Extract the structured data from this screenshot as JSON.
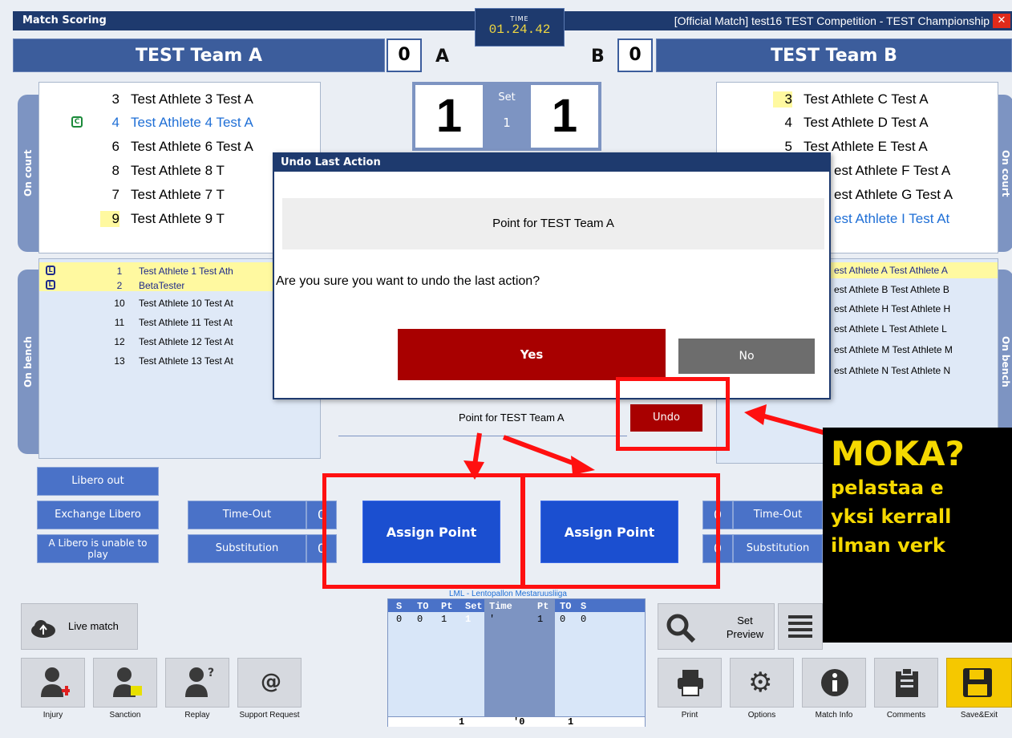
{
  "window": {
    "title": "Match Scoring",
    "match_info": "[Official Match]  test16  TEST Competition - TEST Championship",
    "close": "✕"
  },
  "time": {
    "label": "TIME",
    "value": "01.24.42"
  },
  "teamA": {
    "name": "TEST Team A",
    "score": "0",
    "side": "A",
    "sets": "1"
  },
  "teamB": {
    "name": "TEST Team B",
    "score": "0",
    "side": "B",
    "sets": "1"
  },
  "set": {
    "label": "Set",
    "number": "1"
  },
  "tabs": {
    "on_court": "On court",
    "on_bench": "On bench"
  },
  "courtA": [
    {
      "num": "3",
      "name": "Test Athlete 3 Test A"
    },
    {
      "num": "4",
      "name": "Test Athlete 4 Test A",
      "captain": "C"
    },
    {
      "num": "6",
      "name": "Test Athlete 6 Test A"
    },
    {
      "num": "8",
      "name": "Test Athlete 8 T"
    },
    {
      "num": "7",
      "name": "Test Athlete 7 T"
    },
    {
      "num": "9",
      "name": "Test Athlete 9 T"
    }
  ],
  "courtB": [
    {
      "num": "3",
      "name": "Test Athlete C Test A"
    },
    {
      "num": "4",
      "name": "Test Athlete D Test A"
    },
    {
      "num": "5",
      "name": "Test Athlete E Test A"
    },
    {
      "name": "est Athlete F Test A"
    },
    {
      "name": "est Athlete G Test A"
    },
    {
      "name": "est Athlete I Test At"
    }
  ],
  "benchA": [
    {
      "num": "1",
      "name": "Test Athlete 1 Test Ath",
      "libero": "L"
    },
    {
      "num": "2",
      "name": "BetaTester",
      "libero": "L"
    },
    {
      "num": "10",
      "name": "Test Athlete 10 Test At"
    },
    {
      "num": "11",
      "name": "Test Athlete 11 Test At"
    },
    {
      "num": "12",
      "name": "Test Athlete 12 Test At"
    },
    {
      "num": "13",
      "name": "Test Athlete 13 Test At"
    }
  ],
  "benchB": [
    "est Athlete A Test Athlete A",
    "est Athlete B Test Athlete B",
    "est Athlete H Test Athlete H",
    "est Athlete L Test Athlete L",
    "est Athlete M Test Athlete M",
    "est Athlete N Test Athlete N"
  ],
  "dialog": {
    "title": "Undo Last Action",
    "message": "Point for TEST Team A",
    "question": "Are you sure you want to undo the last action?",
    "yes": "Yes",
    "no": "No"
  },
  "last_action": {
    "text": "Point for TEST Team A",
    "undo": "Undo"
  },
  "controls": {
    "libero_out": "Libero out",
    "exchange_libero": "Exchange Libero",
    "libero_unable": "A Libero is unable to play",
    "time_out": "Time-Out",
    "substitution": "Substitution",
    "time_out_count": "0",
    "substitution_count": "0",
    "assign_point": "Assign Point"
  },
  "league": "LML - Lentopallon Mestaruusliiga",
  "set_summary": {
    "headers": [
      "S",
      "TO",
      "Pt",
      "Set",
      "Time",
      "Pt",
      "TO",
      "S"
    ],
    "row": [
      "0",
      "0",
      "1",
      "1",
      "'",
      "1",
      "0",
      "0"
    ],
    "totals": [
      "1",
      "'0",
      "1"
    ]
  },
  "left_tools": {
    "live_match": "Live match",
    "injury": "Injury",
    "sanction": "Sanction",
    "replay": "Replay",
    "support": "Support Request"
  },
  "right_tools": {
    "set_preview": "Set Preview",
    "print": "Print",
    "options": "Options",
    "match_info": "Match Info",
    "comments": "Comments",
    "save_exit": "Save&Exit"
  },
  "annotation": {
    "title": "MOKA?",
    "line1": "pelastaa e",
    "line2": "yksi kerrall",
    "line3": "ilman verk"
  },
  "colors": {
    "highlight": "#ff1010",
    "annot_text": "#f5d800",
    "header": "#1e3a6e"
  }
}
